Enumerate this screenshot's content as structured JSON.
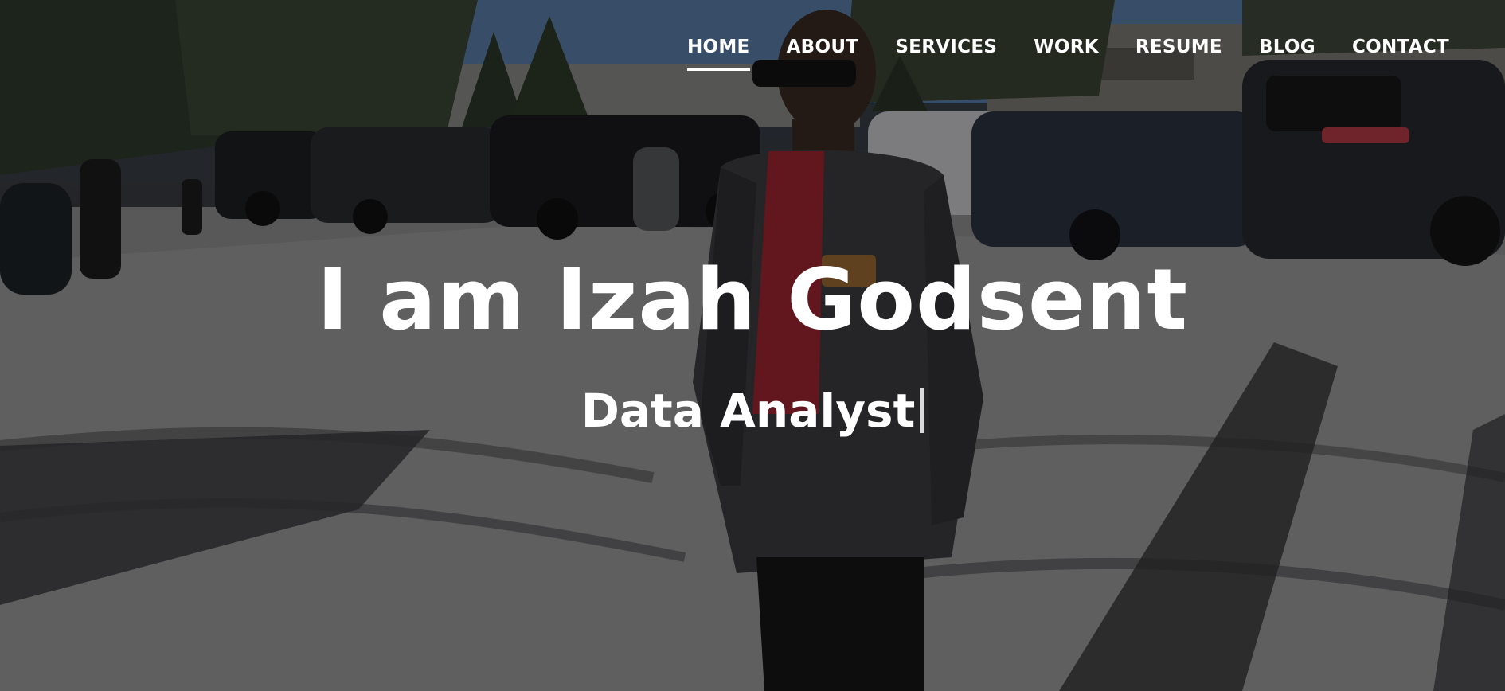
{
  "nav": {
    "items": [
      {
        "label": "HOME",
        "active": true
      },
      {
        "label": "ABOUT",
        "active": false
      },
      {
        "label": "SERVICES",
        "active": false
      },
      {
        "label": "WORK",
        "active": false
      },
      {
        "label": "RESUME",
        "active": false
      },
      {
        "label": "BLOG",
        "active": false
      },
      {
        "label": "CONTACT",
        "active": false
      }
    ]
  },
  "hero": {
    "headline": "I am Izah Godsent",
    "subtitle": "Data Analyst"
  },
  "colors": {
    "text": "#ffffff",
    "caret": "#d9d9d9",
    "sky": "#4f6f95",
    "jacket": "#3d3e42",
    "turtleneck": "#a0242f"
  }
}
